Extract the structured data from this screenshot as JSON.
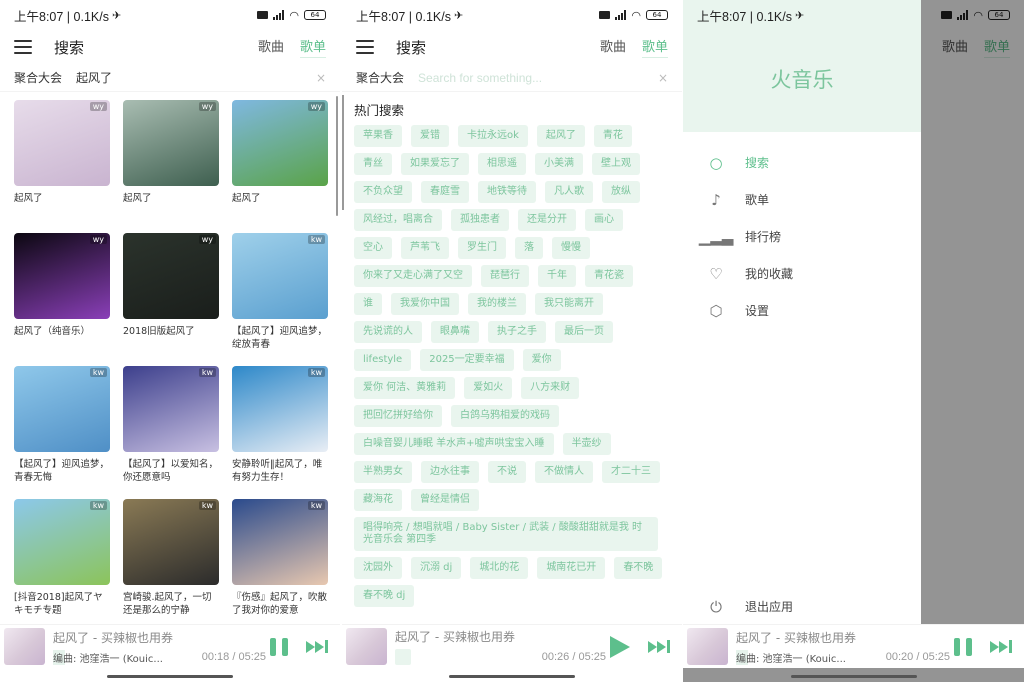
{
  "status": {
    "time": "上午8:07 | 0.1K/s",
    "battery": "64",
    "network": "5G"
  },
  "app": {
    "name": "火音乐"
  },
  "topbar": {
    "title": "搜索",
    "tabs": [
      {
        "label": "歌曲",
        "active": false
      },
      {
        "label": "歌单",
        "active": true
      }
    ]
  },
  "search": {
    "source": "聚合大会",
    "query": "起风了",
    "placeholder": "Search for something...",
    "clear": "×"
  },
  "results": [
    {
      "name": "起风了",
      "badge": "wy",
      "colors": [
        "#e7dcea",
        "#c9b4d0"
      ]
    },
    {
      "name": "起风了",
      "badge": "wy",
      "colors": [
        "#a9bdb2",
        "#3e5f4f"
      ]
    },
    {
      "name": "起风了",
      "badge": "wy",
      "colors": [
        "#7fb8e0",
        "#5aa348"
      ]
    },
    {
      "name": "起风了（纯音乐）",
      "badge": "wy",
      "colors": [
        "#0b0710",
        "#8a3fb8"
      ]
    },
    {
      "name": "2018旧版起风了",
      "badge": "wy",
      "colors": [
        "#2b332c",
        "#1a1e1b"
      ]
    },
    {
      "name": "【起风了】迎风追梦，绽放青春",
      "badge": "kw",
      "colors": [
        "#9fd0ea",
        "#5a9fcf"
      ]
    },
    {
      "name": "【起风了】迎风追梦，青春无悔",
      "badge": "kw",
      "colors": [
        "#8fc8ea",
        "#4f8fc6"
      ]
    },
    {
      "name": "【起风了】以爱知名，你还愿意吗",
      "badge": "kw",
      "colors": [
        "#3c3f8c",
        "#c8c0e2"
      ]
    },
    {
      "name": "安静聆听‖起风了，唯有努力生存！",
      "badge": "kw",
      "colors": [
        "#2d88c9",
        "#e9eef5"
      ]
    },
    {
      "name": "[抖音2018]起风了ヤキモチ专题",
      "badge": "kw",
      "colors": [
        "#8cc8ea",
        "#8cc45a"
      ]
    },
    {
      "name": "宫崎骏.起风了，一切还是那么的宁静",
      "badge": "kw",
      "colors": [
        "#8a7a55",
        "#2b2b2b"
      ]
    },
    {
      "name": "『伤感』起风了，吹散了我对你的爱意",
      "badge": "kw",
      "colors": [
        "#2a4a8c",
        "#e8c8b0"
      ]
    }
  ],
  "hot_search": {
    "title": "热门搜索",
    "tags": [
      "苹果香",
      "爱错",
      "卡拉永远ok",
      "起风了",
      "青花",
      "青丝",
      "如果爱忘了",
      "相思遥",
      "小美满",
      "壁上观",
      "不负众望",
      "春庭雪",
      "地铁等待",
      "凡人歌",
      "放纵",
      "风经过，唱离合",
      "孤独患者",
      "还是分开",
      "画心",
      "空心",
      "芦苇飞",
      "罗生门",
      "落",
      "慢慢",
      "你来了又走心满了又空",
      "琵琶行",
      "千年",
      "青花瓷",
      "谁",
      "我爱你中国",
      "我的楼兰",
      "我只能离开",
      "先说谎的人",
      "眼鼻嘴",
      "执子之手",
      "最后一页",
      "lifestyle",
      "2025一定要幸福",
      "爱你",
      "爱你 何洁、黄雅莉",
      "爱如火",
      "八方来财",
      "把回忆拼好给你",
      "白鸽乌鸦相爱的戏码",
      "白噪音婴儿睡眠 羊水声+嘘声哄宝宝入睡",
      "半壶纱",
      "半熟男女",
      "边水往事",
      "不说",
      "不做情人",
      "才二十三",
      "藏海花",
      "曾经是情侣",
      "唱得响亮 / 想唱就唱 / Baby Sister / 武装 / 酸酸甜甜就是我 时光音乐会 第四季",
      "沈园外",
      "沉溺 dj",
      "城北的花",
      "城南花已开",
      "春不晚",
      "春不晚 dj"
    ]
  },
  "drawer": {
    "items": [
      {
        "label": "搜索",
        "icon": "search-icon",
        "active": true
      },
      {
        "label": "歌单",
        "icon": "playlist-icon",
        "active": false
      },
      {
        "label": "排行榜",
        "icon": "chart-icon",
        "active": false
      },
      {
        "label": "我的收藏",
        "icon": "heart-icon",
        "active": false
      },
      {
        "label": "设置",
        "icon": "settings-icon",
        "active": false
      }
    ],
    "exit": {
      "label": "退出应用",
      "icon": "power-icon"
    }
  },
  "players": [
    {
      "song": "起风了 - 买辣椒也用券",
      "composer": "编曲: 池窪浩一 (Kouic...",
      "current": "00:18",
      "total": "05:25",
      "playing": true
    },
    {
      "song": "起风了 - 买辣椒也用券",
      "composer": "",
      "current": "00:26",
      "total": "05:25",
      "playing": false
    },
    {
      "song": "起风了 - 买辣椒也用券",
      "composer": "编曲: 池窪浩一 (Kouic...",
      "current": "00:20",
      "total": "05:25",
      "playing": true
    }
  ],
  "colors": {
    "accent": "#5dbf8c",
    "tag_bg": "#e9f5ee",
    "tag_text": "#7cc59d"
  }
}
